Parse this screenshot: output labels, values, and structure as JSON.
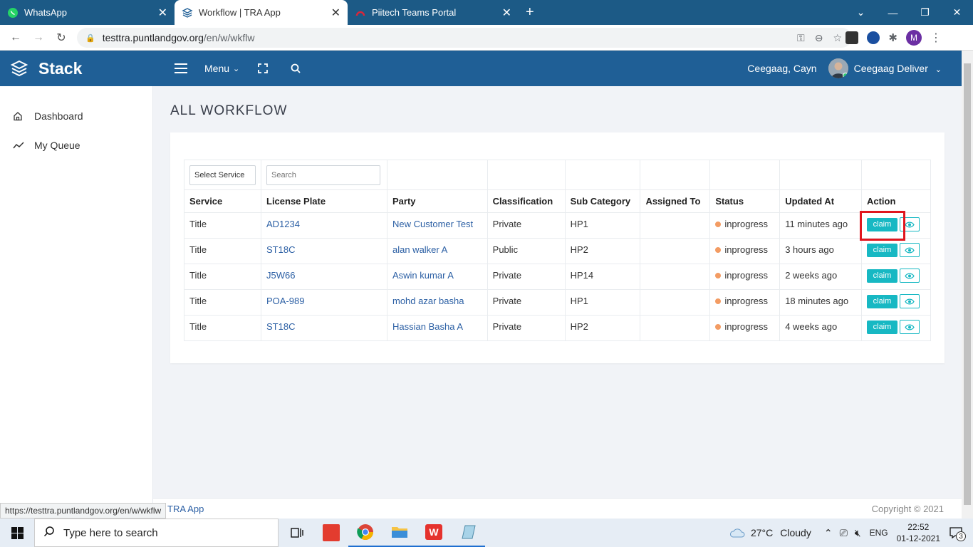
{
  "browser": {
    "tabs": [
      {
        "label": "WhatsApp",
        "active": false
      },
      {
        "label": "Workflow | TRA App",
        "active": true
      },
      {
        "label": "Piitech Teams Portal",
        "active": false
      }
    ],
    "url_host": "testtra.puntlandgov.org",
    "url_path": "/en/w/wkflw",
    "profile_initial": "M",
    "status_url": "https://testtra.puntlandgov.org/en/w/wkflw"
  },
  "header": {
    "brand": "Stack",
    "menu_label": "Menu",
    "user_short": "Ceegaag, Cayn",
    "user_name": "Ceegaag Deliver"
  },
  "sidebar": {
    "items": [
      {
        "label": "Dashboard",
        "icon": "home-icon"
      },
      {
        "label": "My Queue",
        "icon": "trend-icon"
      }
    ]
  },
  "page": {
    "title": "ALL WORKFLOW",
    "filters": {
      "service_select": "Select Service",
      "search_placeholder": "Search"
    },
    "columns": [
      "Service",
      "License Plate",
      "Party",
      "Classification",
      "Sub Category",
      "Assigned To",
      "Status",
      "Updated At",
      "Action"
    ],
    "rows": [
      {
        "service": "Title",
        "plate": "AD1234",
        "party": "New Customer Test",
        "classification": "Private",
        "sub_category": "HP1",
        "assigned_to": "",
        "status": "inprogress",
        "updated": "11 minutes ago",
        "action": "claim"
      },
      {
        "service": "Title",
        "plate": "ST18C",
        "party": "alan walker A",
        "classification": "Public",
        "sub_category": "HP2",
        "assigned_to": "",
        "status": "inprogress",
        "updated": "3 hours ago",
        "action": "claim"
      },
      {
        "service": "Title",
        "plate": "J5W66",
        "party": "Aswin kumar A",
        "classification": "Private",
        "sub_category": "HP14",
        "assigned_to": "",
        "status": "inprogress",
        "updated": "2 weeks ago",
        "action": "claim"
      },
      {
        "service": "Title",
        "plate": "POA-989",
        "party": "mohd azar basha",
        "classification": "Private",
        "sub_category": "HP1",
        "assigned_to": "",
        "status": "inprogress",
        "updated": "18 minutes ago",
        "action": "claim"
      },
      {
        "service": "Title",
        "plate": "ST18C",
        "party": "Hassian Basha A",
        "classification": "Private",
        "sub_category": "HP2",
        "assigned_to": "",
        "status": "inprogress",
        "updated": "4 weeks ago",
        "action": "claim"
      }
    ]
  },
  "footer": {
    "brand": "TRA App",
    "copyright": "Copyright © 2021"
  },
  "taskbar": {
    "search_placeholder": "Type here to search",
    "weather_temp": "27°C",
    "weather_desc": "Cloudy",
    "language": "ENG",
    "time": "22:52",
    "date": "01-12-2021",
    "notifications": "3"
  },
  "colors": {
    "brand_blue": "#1f5f96",
    "tab_strip": "#1c5a86",
    "accent_teal": "#17b8c3",
    "status_orange": "#f39c63",
    "highlight_red": "#e1161e"
  }
}
